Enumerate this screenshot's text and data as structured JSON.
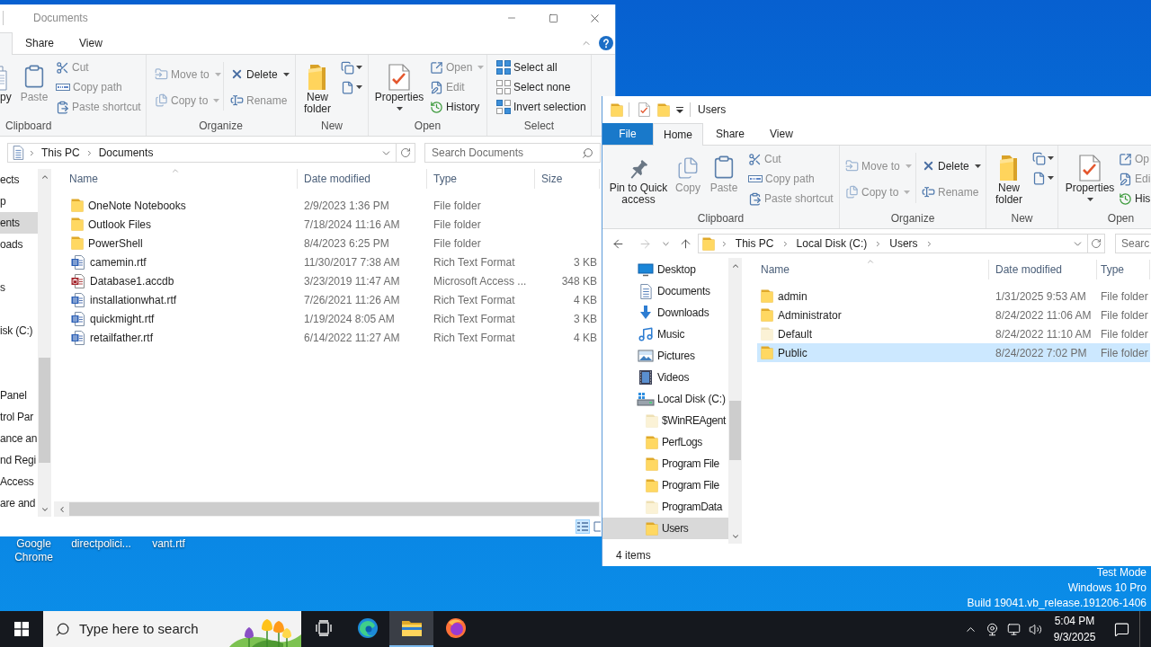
{
  "desktop": {
    "icons": [
      {
        "label": "Google Chrome"
      },
      {
        "label": "directpolici..."
      },
      {
        "label": "vant.rtf"
      }
    ],
    "edition": [
      "Test Mode",
      "Windows 10 Pro",
      "Build 19041.vb_release.191206-1406"
    ]
  },
  "windows": [
    {
      "title": "Documents",
      "active": false,
      "tabs": [
        {
          "kind": "tab",
          "selected": true
        },
        {
          "kind": "tab",
          "label": "Share",
          "selected": false
        },
        {
          "kind": "tab",
          "label": "View",
          "selected": false
        }
      ],
      "ribbon": [
        {
          "label": "Clipboard",
          "items": [
            {
              "label": "py",
              "disabled": false
            },
            {
              "label": "Paste",
              "disabled": true
            },
            {
              "label": "Cut",
              "disabled": true
            },
            {
              "label": "Copy path",
              "disabled": true
            },
            {
              "label": "Paste shortcut",
              "disabled": true
            }
          ]
        },
        {
          "label": "Organize",
          "items": [
            {
              "label": "Move to",
              "disabled": true
            },
            {
              "label": "Copy to",
              "disabled": true
            },
            {
              "label": "Delete",
              "disabled": false
            },
            {
              "label": "Rename",
              "disabled": true
            }
          ]
        },
        {
          "label": "New",
          "items": [
            {
              "label": "New folder",
              "disabled": false
            }
          ]
        },
        {
          "label": "Open",
          "items": [
            {
              "label": "Properties",
              "disabled": false
            },
            {
              "label": "Open",
              "disabled": true
            },
            {
              "label": "Edit",
              "disabled": true
            },
            {
              "label": "History",
              "disabled": false
            }
          ]
        },
        {
          "label": "Select",
          "items": [
            {
              "label": "Select all",
              "disabled": false
            },
            {
              "label": "Select none",
              "disabled": false
            },
            {
              "label": "Invert selection",
              "disabled": false
            }
          ]
        }
      ],
      "address": {
        "breadcrumbs": [
          "This PC",
          "Documents"
        ]
      },
      "search": {
        "placeholder": "Search Documents"
      },
      "nav": [
        {
          "label": "ects",
          "selected": false
        },
        {
          "label": "p",
          "selected": false
        },
        {
          "label": "ents",
          "selected": true
        },
        {
          "label": "oads",
          "selected": false
        },
        {
          "label": "s",
          "selected": false
        },
        {
          "label": "isk (C:)",
          "selected": false
        },
        {
          "label": "Panel",
          "selected": false
        },
        {
          "label": "trol Par",
          "selected": false
        },
        {
          "label": "ance an",
          "selected": false
        },
        {
          "label": "nd Regi",
          "selected": false
        },
        {
          "label": "Access",
          "selected": false
        },
        {
          "label": "are and",
          "selected": false
        }
      ],
      "table": {
        "columns": [
          {
            "label": "Name",
            "sorted": true
          },
          {
            "label": "Date modified",
            "sorted": false
          },
          {
            "label": "Type",
            "sorted": false
          },
          {
            "label": "Size",
            "sorted": false
          }
        ],
        "rows": [
          {
            "kind": "folder",
            "name": "OneNote Notebooks",
            "date": "2/9/2023 1:36 PM",
            "type": "File folder",
            "selected": false
          },
          {
            "kind": "folder",
            "name": "Outlook Files",
            "date": "7/18/2024 11:16 AM",
            "type": "File folder",
            "selected": false
          },
          {
            "kind": "folder",
            "name": "PowerShell",
            "date": "8/4/2023 6:25 PM",
            "type": "File folder",
            "selected": false
          },
          {
            "kind": "document",
            "name": "camemin.rtf",
            "date": "11/30/2017 7:38 AM",
            "type": "Rich Text Format",
            "size": "3 KB",
            "selected": false
          },
          {
            "kind": "database",
            "name": "Database1.accdb",
            "date": "3/23/2019 11:47 AM",
            "type": "Microsoft Access ...",
            "size": "348 KB",
            "selected": false
          },
          {
            "kind": "document",
            "name": "installationwhat.rtf",
            "date": "7/26/2021 11:26 AM",
            "type": "Rich Text Format",
            "size": "4 KB",
            "selected": false
          },
          {
            "kind": "document",
            "name": "quickmight.rtf",
            "date": "1/19/2024 8:05 AM",
            "type": "Rich Text Format",
            "size": "3 KB",
            "selected": false
          },
          {
            "kind": "document",
            "name": "retailfather.rtf",
            "date": "6/14/2022 11:27 AM",
            "type": "Rich Text Format",
            "size": "4 KB",
            "selected": false
          }
        ]
      },
      "views": [
        {
          "selected": true
        },
        {
          "selected": false
        }
      ]
    },
    {
      "title": "Users",
      "active": true,
      "tabs": [
        {
          "kind": "file",
          "label": "File",
          "selected": false
        },
        {
          "kind": "tab",
          "label": "Home",
          "selected": true
        },
        {
          "kind": "tab",
          "label": "Share",
          "selected": false
        },
        {
          "kind": "tab",
          "label": "View",
          "selected": false
        }
      ],
      "ribbon": [
        {
          "label": "Clipboard",
          "items": [
            {
              "label": "Pin to Quick access",
              "disabled": false
            },
            {
              "label": "Copy",
              "disabled": true
            },
            {
              "label": "Paste",
              "disabled": true
            },
            {
              "label": "Cut",
              "disabled": true
            },
            {
              "label": "Copy path",
              "disabled": true
            },
            {
              "label": "Paste shortcut",
              "disabled": true
            }
          ]
        },
        {
          "label": "Organize",
          "items": [
            {
              "label": "Move to",
              "disabled": true
            },
            {
              "label": "Copy to",
              "disabled": true
            },
            {
              "label": "Delete",
              "disabled": false
            },
            {
              "label": "Rename",
              "disabled": true
            }
          ]
        },
        {
          "label": "New",
          "items": [
            {
              "label": "New folder",
              "disabled": false
            }
          ]
        },
        {
          "label": "Open",
          "items": [
            {
              "label": "Properties",
              "disabled": false
            },
            {
              "label": "Op",
              "disabled": true
            },
            {
              "label": "Edi",
              "disabled": true
            },
            {
              "label": "His",
              "disabled": false
            }
          ]
        }
      ],
      "history": {
        "back_disabled": false,
        "forward_disabled": true
      },
      "address": {
        "breadcrumbs": [
          "This PC",
          "Local Disk (C:)",
          "Users"
        ]
      },
      "search": {
        "placeholder": "Searc"
      },
      "nav": [
        {
          "kind": "desktop",
          "label": "Desktop",
          "selected": false
        },
        {
          "kind": "documents",
          "label": "Documents",
          "selected": false
        },
        {
          "kind": "downloads",
          "label": "Downloads",
          "selected": false
        },
        {
          "kind": "music",
          "label": "Music",
          "selected": false
        },
        {
          "kind": "pictures",
          "label": "Pictures",
          "selected": false
        },
        {
          "kind": "videos",
          "label": "Videos",
          "selected": false
        },
        {
          "kind": "drive",
          "label": "Local Disk (C:)",
          "selected": false,
          "children": [
            {
              "label": "$WinREAgent",
              "hidden": true,
              "selected": false
            },
            {
              "label": "PerfLogs",
              "hidden": false,
              "selected": false
            },
            {
              "label": "Program File",
              "hidden": false,
              "selected": false
            },
            {
              "label": "Program File",
              "hidden": false,
              "selected": false
            },
            {
              "label": "ProgramData",
              "hidden": true,
              "selected": false
            },
            {
              "label": "Users",
              "hidden": false,
              "selected": true
            }
          ]
        }
      ],
      "table": {
        "columns": [
          {
            "label": "Name",
            "sorted": true
          },
          {
            "label": "Date modified",
            "sorted": false
          },
          {
            "label": "Type",
            "sorted": false
          }
        ],
        "rows": [
          {
            "kind": "folder",
            "name": "admin",
            "date": "1/31/2025 9:53 AM",
            "type": "File folder",
            "hidden": false,
            "selected": false
          },
          {
            "kind": "folder",
            "name": "Administrator",
            "date": "8/24/2022 11:06 AM",
            "type": "File folder",
            "hidden": false,
            "selected": false
          },
          {
            "kind": "folder",
            "name": "Default",
            "date": "8/24/2022 11:10 AM",
            "type": "File folder",
            "hidden": true,
            "selected": false
          },
          {
            "kind": "folder",
            "name": "Public",
            "date": "8/24/2022 7:02 PM",
            "type": "File folder",
            "hidden": false,
            "selected": true
          }
        ]
      },
      "status": "4 items"
    }
  ],
  "taskbar": {
    "search": {
      "placeholder": "Type here to search"
    },
    "apps": [
      {
        "selected": false
      },
      {
        "selected": false
      },
      {
        "selected": true
      },
      {
        "selected": false
      }
    ],
    "clock": {
      "time": "5:04 PM",
      "date": "9/3/2025"
    }
  }
}
